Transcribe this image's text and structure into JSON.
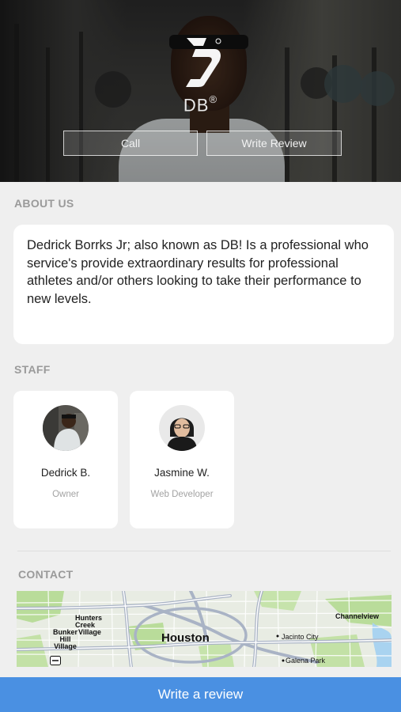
{
  "hero": {
    "brand_text": "DB",
    "registered_mark": "®",
    "call_label": "Call",
    "write_review_label": "Write Review"
  },
  "about": {
    "title": "ABOUT US",
    "text": "Dedrick Borrks Jr; also known as DB! Is a professional who service's provide extraordinary results for professional athletes and/or others looking to take their performance to new levels."
  },
  "staff": {
    "title": "STAFF",
    "members": [
      {
        "name": "Dedrick B.",
        "role": "Owner"
      },
      {
        "name": "Jasmine W.",
        "role": "Web Developer"
      }
    ]
  },
  "contact": {
    "title": "CONTACT",
    "map_labels": {
      "hunters_creek": "Hunters\nCreek",
      "village": "Village",
      "bunker_hill": "Bunker\nHill\nVillage",
      "houston": "Houston",
      "channelview": "Channelview",
      "jacinto_city": "Jacinto City",
      "galena_park": "Galena Park"
    }
  },
  "footer": {
    "write_review_label": "Write a review"
  },
  "colors": {
    "accent": "#4a90e2",
    "background": "#efefef",
    "section_title": "#9a9a9a",
    "card": "#ffffff"
  }
}
